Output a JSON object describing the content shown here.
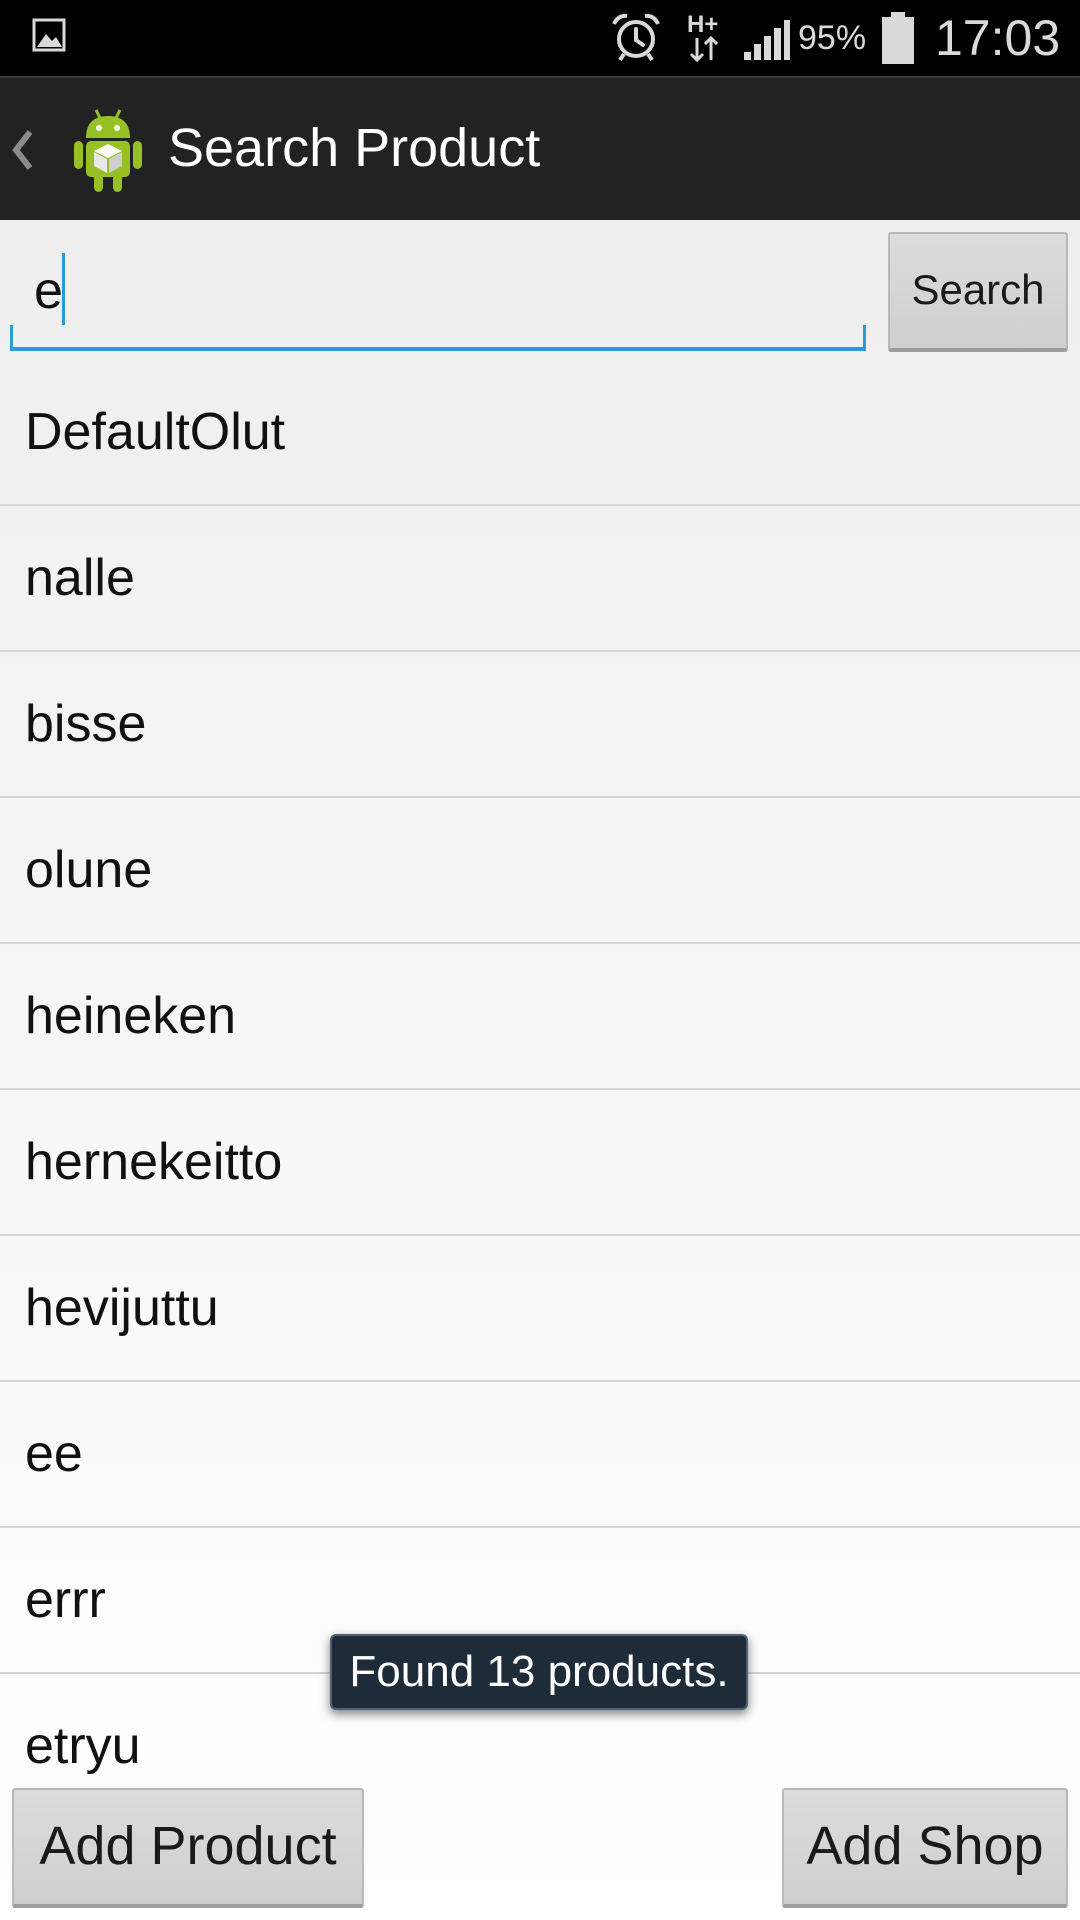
{
  "status_bar": {
    "battery_percent": "95%",
    "time": "17:03",
    "icons": [
      "gallery-icon",
      "alarm-icon",
      "hspa-plus-icon",
      "signal-icon",
      "battery-icon"
    ]
  },
  "action_bar": {
    "title": "Search Product",
    "icons": [
      "back-chevron-icon",
      "android-app-icon"
    ]
  },
  "search": {
    "value": "e",
    "button_label": "Search"
  },
  "products": [
    "DefaultOlut",
    "nalle",
    "bisse",
    "olune",
    "heineken",
    "hernekeitto",
    "hevijuttu",
    "ee",
    "errr",
    "etryu"
  ],
  "toast": {
    "message": "Found 13 products."
  },
  "bottom_buttons": {
    "add_product_label": "Add Product",
    "add_shop_label": "Add Shop"
  },
  "colors": {
    "accent": "#2b9ad6",
    "action_bar": "#222222",
    "toast_bg": "#1e2c3a",
    "android_green": "#97c024"
  }
}
